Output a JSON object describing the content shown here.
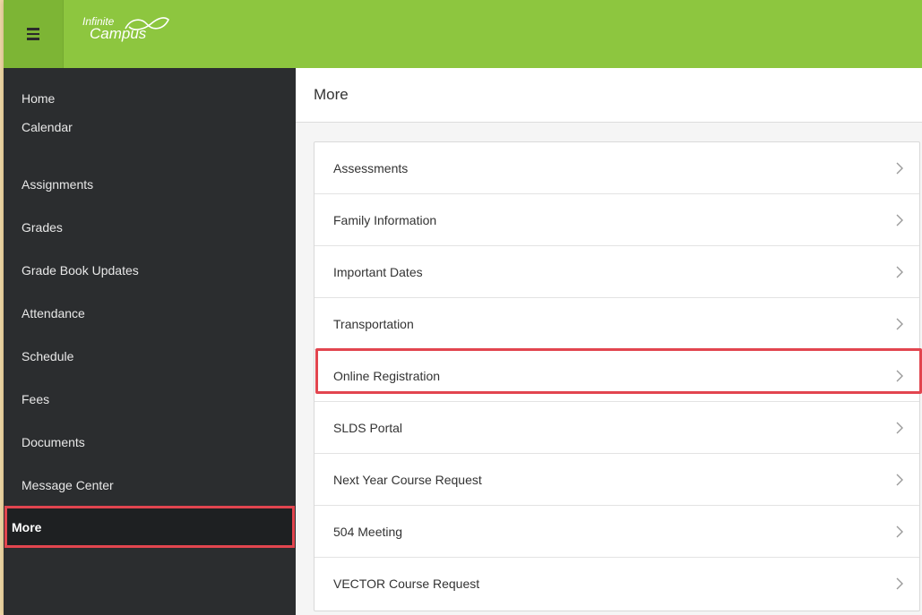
{
  "app": {
    "logo_top": "Infinite",
    "logo_bottom": "Campus"
  },
  "sidebar": {
    "items": [
      {
        "label": "Home"
      },
      {
        "label": "Calendar"
      },
      {
        "label": "Assignments"
      },
      {
        "label": "Grades"
      },
      {
        "label": "Grade Book Updates"
      },
      {
        "label": "Attendance"
      },
      {
        "label": "Schedule"
      },
      {
        "label": "Fees"
      },
      {
        "label": "Documents"
      },
      {
        "label": "Message Center"
      },
      {
        "label": "More",
        "active": true
      }
    ]
  },
  "main": {
    "title": "More",
    "items": [
      {
        "label": "Assessments"
      },
      {
        "label": "Family Information"
      },
      {
        "label": "Important Dates"
      },
      {
        "label": "Transportation"
      },
      {
        "label": "Online Registration",
        "highlighted": true
      },
      {
        "label": "SLDS Portal"
      },
      {
        "label": "Next Year Course Request"
      },
      {
        "label": "504 Meeting"
      },
      {
        "label": "VECTOR Course Request"
      }
    ]
  },
  "colors": {
    "topbar": "#8dc63f",
    "sidebar": "#2b2d2f",
    "highlight": "#e2454f"
  },
  "icons": {
    "menu": "hamburger-menu-icon",
    "logo": "infinite-campus-logo",
    "row": "chevron-right-icon"
  }
}
